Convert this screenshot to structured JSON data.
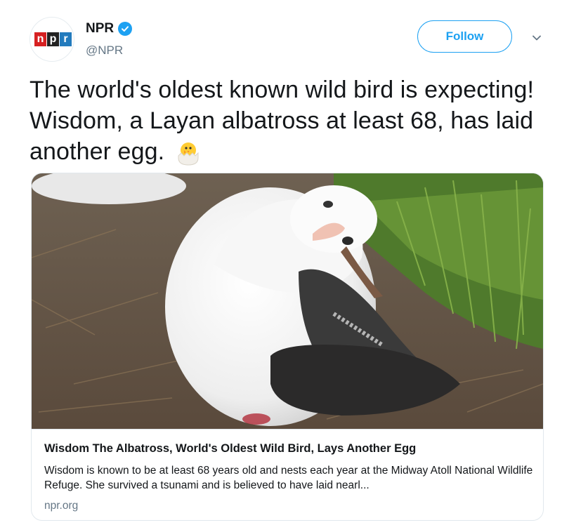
{
  "author": {
    "display_name": "NPR",
    "handle": "@NPR",
    "verified": true,
    "avatar_logo_letters": [
      "n",
      "p",
      "r"
    ]
  },
  "follow_label": "Follow",
  "tweet_text": "The world's oldest known wild bird is expecting! Wisdom, a Layan albatross at least 68, has laid another egg.",
  "emoji": "hatching-chick",
  "card": {
    "image_icon": "albatross-photo",
    "title": "Wisdom The Albatross, World's Oldest Wild Bird, Lays Another Egg",
    "description": "Wisdom is known to be at least 68 years old and nests each year at the Midway Atoll National Wildlife Refuge. She survived a tsunami and is believed to have laid nearl...",
    "domain": "npr.org"
  },
  "colors": {
    "accent": "#1da1f2",
    "text": "#14171a",
    "secondary_text": "#657786",
    "npr_red": "#d62021",
    "npr_black": "#222222",
    "npr_blue": "#237bbd"
  }
}
